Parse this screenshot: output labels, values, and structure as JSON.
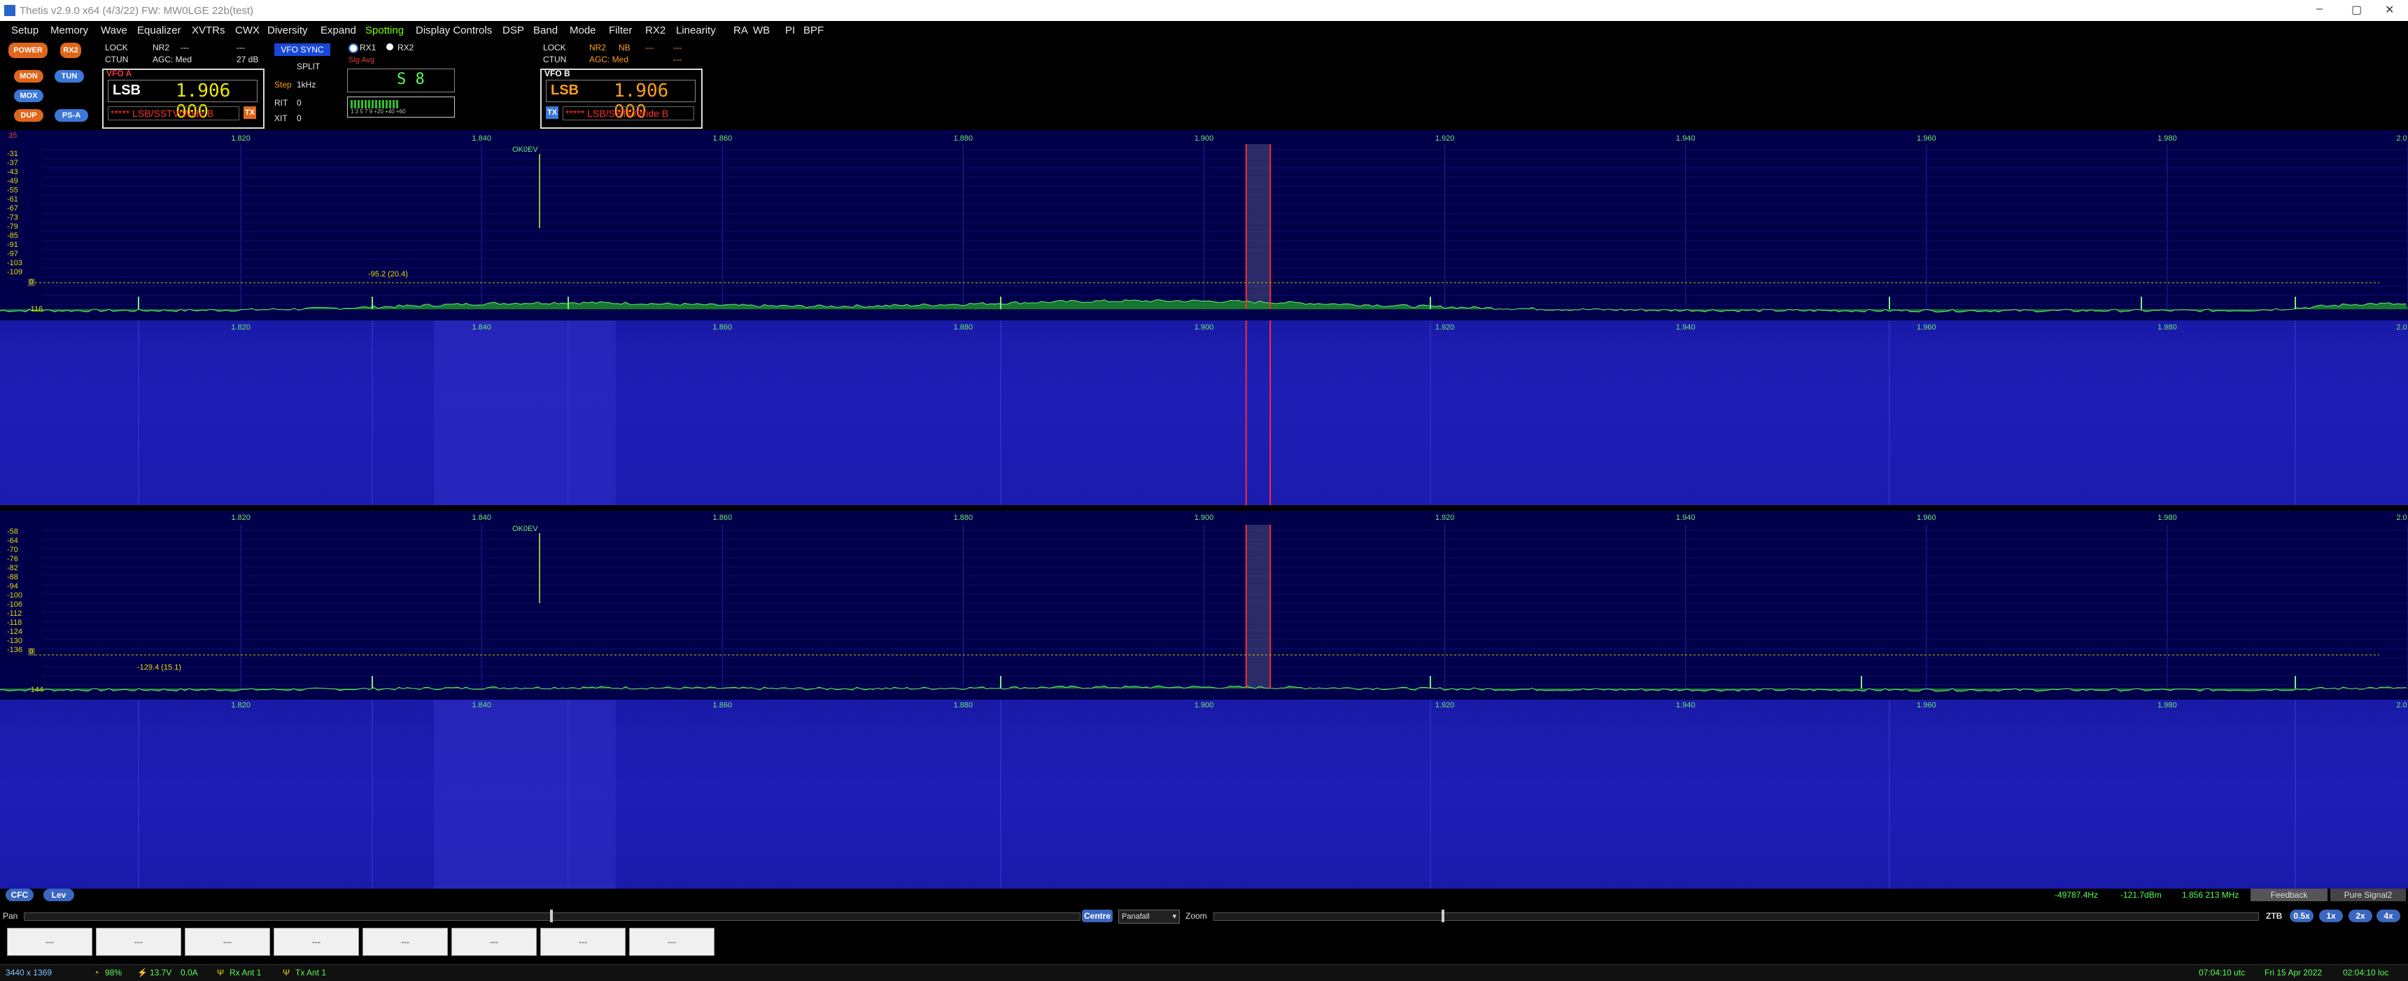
{
  "window": {
    "title": "Thetis v2.9.0 x64 (4/3/22) FW: MW0LGE 22b(test)",
    "controls": [
      "–",
      "▢",
      "✕"
    ]
  },
  "menu": [
    "Setup",
    "Memory",
    "Wave",
    "Equalizer",
    "XVTRs",
    "CWX",
    "Diversity",
    "Expand",
    "Spotting",
    "Display Controls",
    "DSP",
    "Band",
    "Mode",
    "Filter",
    "RX2",
    "Linearity",
    "RA",
    "WB",
    "PI",
    "BPF"
  ],
  "menu_active": "Spotting",
  "buttons": {
    "power": "POWER",
    "rx2": "RX2",
    "mon": "MON",
    "tun": "TUN",
    "mox": "MOX",
    "dup": "DUP",
    "psa": "PS-A",
    "vfo_sync": "VFO SYNC",
    "split": "SPLIT"
  },
  "rx1_status": {
    "lock": "LOCK",
    "nr2": "NR2",
    "d1": "---",
    "d2": "---",
    "ctun": "CTUN",
    "agc": "AGC: Med",
    "db": "27 dB"
  },
  "vfo_a": {
    "label": "VFO A",
    "mode": "LSB",
    "freq": "1.906 000",
    "sub": "***** LSB/SSTV/Wide B",
    "tx": "TX"
  },
  "tuning": {
    "step_label": "Step",
    "step_value": "1kHz",
    "rit_label": "RIT",
    "rit_value": "0",
    "xit_label": "XIT",
    "xit_value": "0"
  },
  "rx_select": {
    "rx1": "RX1",
    "rx2": "RX2",
    "sig_avg": "Sig Avg"
  },
  "smeter": {
    "reading": "S 8",
    "scale": "1 3 5 7 9 +20 +40 +60"
  },
  "rx2_status": {
    "lock": "LOCK",
    "nr2": "NR2",
    "nb": "NB",
    "d1": "---",
    "d2": "---",
    "ctun": "CTUN",
    "agc": "AGC: Med",
    "d3": "---"
  },
  "vfo_b": {
    "label": "VFO B",
    "mode": "LSB",
    "freq": "1.906 000",
    "sub": "***** LSB/SSTV/Wide B",
    "tx": "TX"
  },
  "freq_ticks": [
    "1.820",
    "1.840",
    "1.860",
    "1.880",
    "1.900",
    "1.920",
    "1.940",
    "1.960",
    "1.980",
    "2.0"
  ],
  "rx1_panel": {
    "top_db": "35",
    "db_ticks": [
      "-31",
      "-37",
      "-43",
      "-49",
      "-55",
      "-61",
      "-67",
      "-73",
      "-79",
      "-85",
      "-91",
      "-97",
      "-103",
      "-109"
    ],
    "noise_floor": "-116",
    "spot": "OK0EV",
    "peak_marker": "-95.2 (20.4)",
    "marker_label": "0"
  },
  "rx2_panel": {
    "db_ticks": [
      "-58",
      "-64",
      "-70",
      "-76",
      "-82",
      "-88",
      "-94",
      "-100",
      "-106",
      "-112",
      "-118",
      "-124",
      "-130",
      "-136"
    ],
    "noise_floor": "-144",
    "spot": "OK0EV",
    "peak_marker": "-129.4 (15.1)",
    "marker_label": "0"
  },
  "bottom_bar": {
    "cfc": "CFC",
    "lev": "Lev",
    "cursor_offset": "-49787.4Hz",
    "cursor_dbm": "-121.7dBm",
    "cursor_freq": "1.856 213 MHz",
    "feedback": "Feedback",
    "pure_signal": "Pure Signal2",
    "pan_label": "Pan",
    "center": "Centre",
    "display_mode": "Panafall",
    "zoom_label": "Zoom",
    "ztb": "ZTB",
    "zoom_levels": [
      "0.5x",
      "1x",
      "2x",
      "4x"
    ]
  },
  "memory_slots": [
    "---",
    "---",
    "---",
    "---",
    "---",
    "---",
    "---",
    "---"
  ],
  "status": {
    "resolution": "3440 x 1369",
    "cpu": "98%",
    "volts": "13.7V",
    "amps": "0.0A",
    "rx_ant": "Rx Ant 1",
    "tx_ant": "Tx Ant 1",
    "utc": "07:04:10 utc",
    "date": "Fri 15 Apr 2022",
    "local": "02:04:10 loc"
  },
  "colors": {
    "spectrum_bg": "#00004a",
    "waterfall_bg": "#1c1cb0",
    "trace_fill": "#1a8a2c",
    "filter_band": "#ff2a2a",
    "grid": "#2222aa",
    "axis_text": "#6ee86e",
    "db_text": "#e8d800"
  },
  "filter": {
    "low_freq": 1.9035,
    "high_freq": 1.9055,
    "center_freq": 1.906
  },
  "span": {
    "start": 1.8,
    "end": 2.0
  }
}
